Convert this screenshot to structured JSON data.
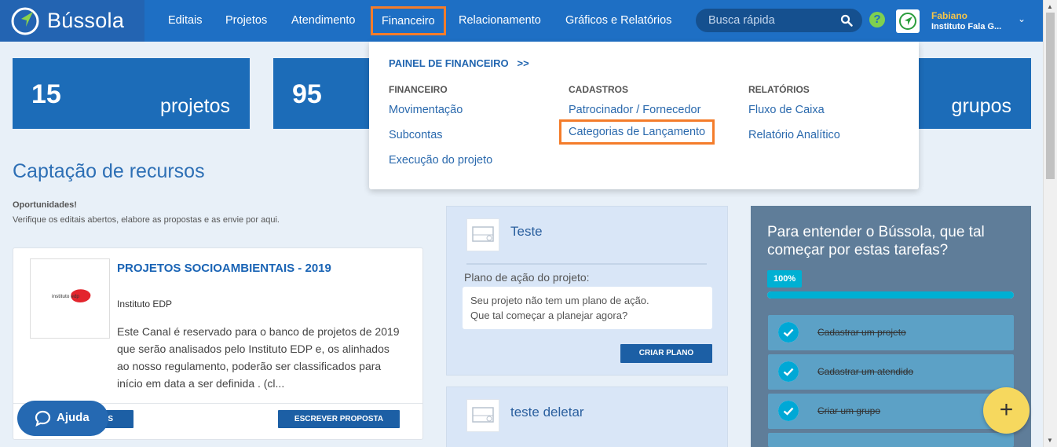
{
  "brand": {
    "name": "Bússola"
  },
  "nav": {
    "items": [
      "Editais",
      "Projetos",
      "Atendimento",
      "Financeiro",
      "Relacionamento",
      "Gráficos e Relatórios"
    ],
    "active": "Financeiro"
  },
  "search": {
    "placeholder": "Busca rápida"
  },
  "user": {
    "name": "Fabiano",
    "org": "Instituto Fala G..."
  },
  "stats": [
    {
      "number": "15",
      "label": "projetos"
    },
    {
      "number": "95",
      "label": ""
    },
    {
      "number": "",
      "label": "grupos"
    }
  ],
  "dropdown": {
    "panel_link": "PAINEL DE FINANCEIRO   >>",
    "columns": [
      {
        "title": "FINANCEIRO",
        "links": [
          "Movimentação",
          "Subcontas",
          "Execução do projeto"
        ]
      },
      {
        "title": "CADASTROS",
        "links": [
          "Patrocinador / Fornecedor",
          "Categorias de Lançamento"
        ]
      },
      {
        "title": "RELATÓRIOS",
        "links": [
          "Fluxo de Caixa",
          "Relatório Analítico"
        ]
      }
    ],
    "highlighted": "Categorias de Lançamento"
  },
  "captacao": {
    "title": "Captação de recursos",
    "subtitle": "Oportunidades!",
    "description": "Verifique os editais abertos, elabore as propostas e as envie por aqui."
  },
  "opportunity": {
    "title": "PROJETOS SOCIOAMBIENTAIS - 2019",
    "institution": "Instituto EDP",
    "description": "Este Canal é reservado para o banco de projetos de 2019 que serão analisados pelo Instituto EDP e, os alinhados ao nosso regulamento, poderão ser classificados para início em data a ser definida . (cl...",
    "logo_text": "instituto edp",
    "left_button_suffix": "S",
    "write_button": "ESCREVER PROPOSTA"
  },
  "help": {
    "label": "Ajuda"
  },
  "projects": [
    {
      "name": "Teste",
      "plan_label": "Plano de ação do projeto:",
      "plan_text_1": "Seu projeto não tem um plano de ação.",
      "plan_text_2": "Que tal começar a planejar agora?",
      "button": "CRIAR PLANO"
    },
    {
      "name": "teste deletar"
    }
  ],
  "tasks": {
    "title": "Para entender o Bússola, que tal começar por estas tarefas?",
    "progress_label": "100%",
    "progress": 1.0,
    "items": [
      "Cadastrar um projeto",
      "Cadastrar um atendido",
      "Criar um grupo"
    ]
  },
  "fab": {
    "label": "+"
  },
  "colors": {
    "nav_bg": "#1e6fc4",
    "accent_orange": "#f47c2a",
    "stat_bg": "#1c6cb8",
    "progress": "#00b0d3",
    "fab": "#f6d85e"
  }
}
